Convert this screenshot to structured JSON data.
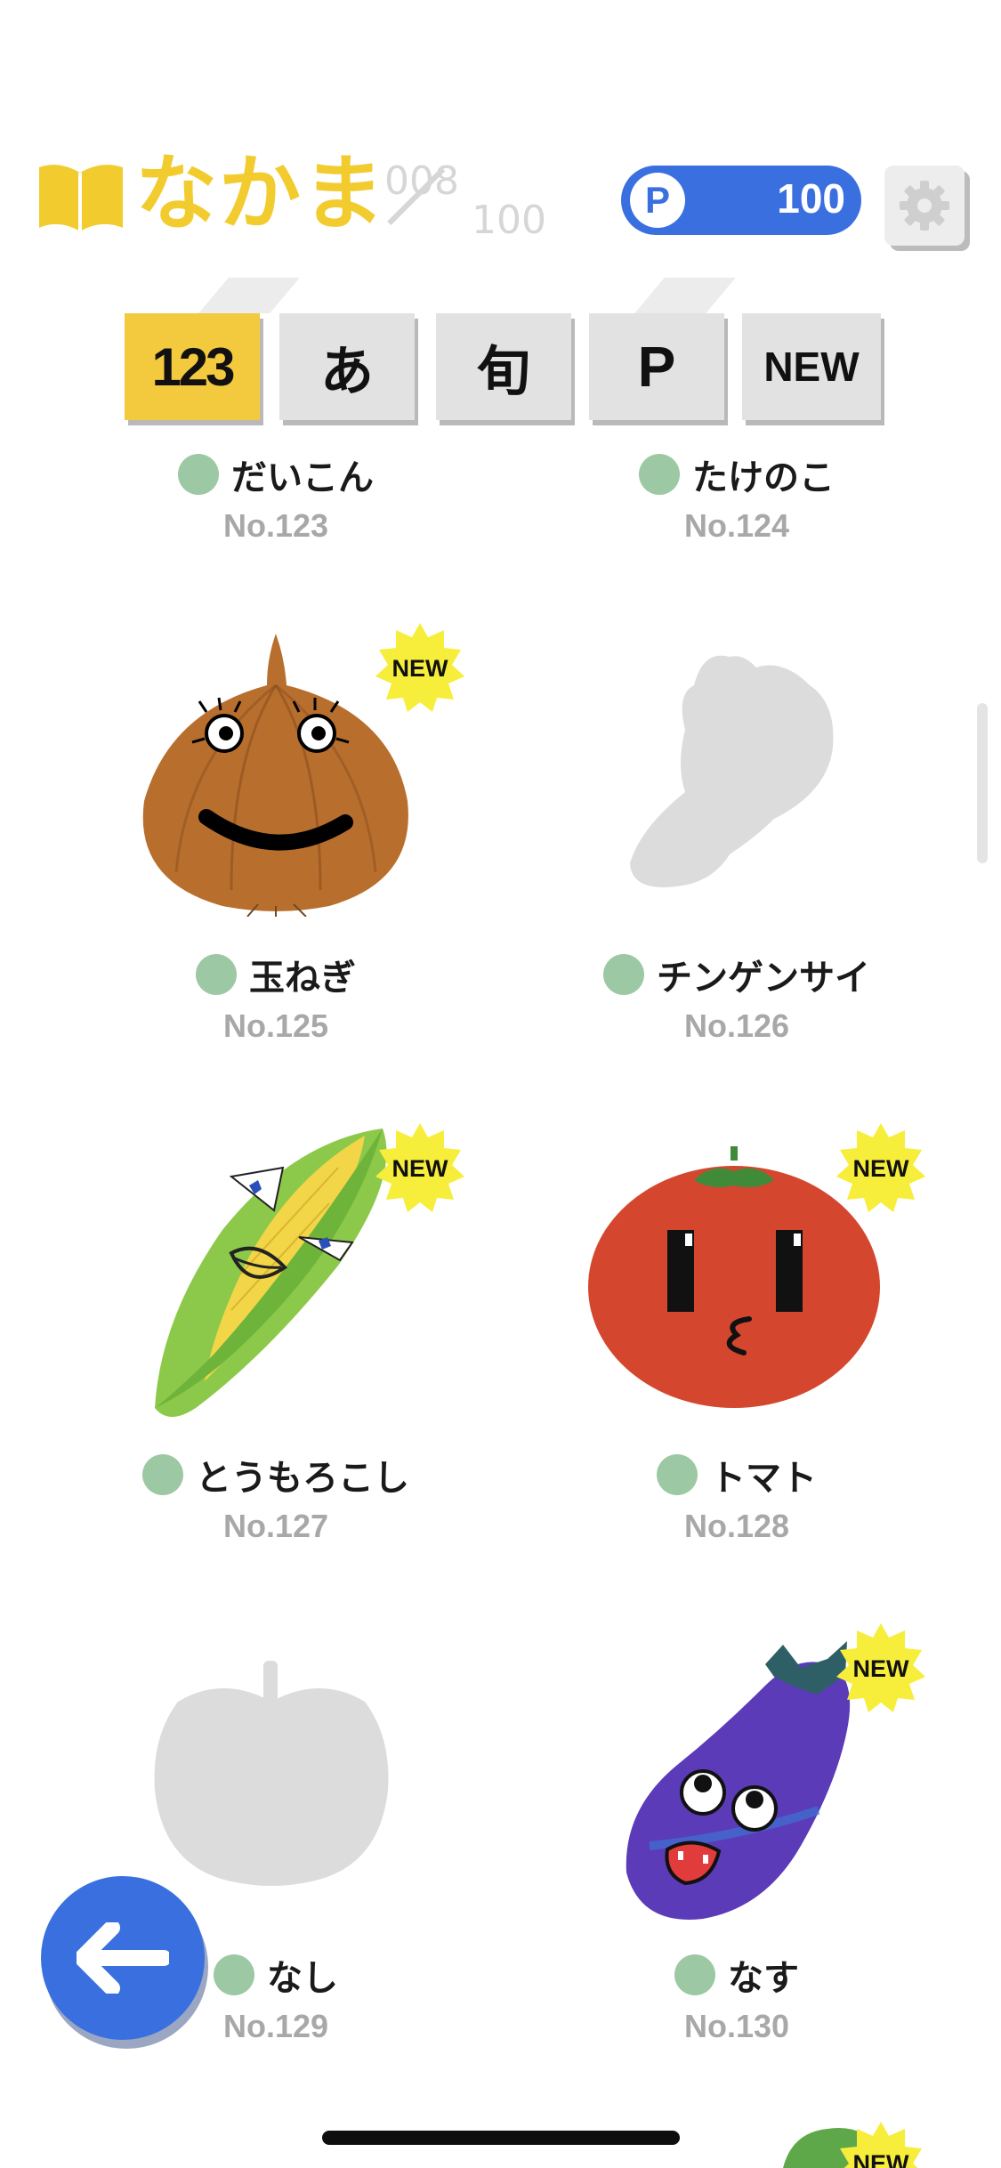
{
  "header": {
    "title": "なかま",
    "collected": "008",
    "total": "100",
    "points_label": "P",
    "points_value": "100"
  },
  "tabs": [
    {
      "label": "123",
      "active": true
    },
    {
      "label": "あ",
      "active": false
    },
    {
      "label": "旬",
      "active": false
    },
    {
      "label": "P",
      "active": false
    },
    {
      "label": "NEW",
      "active": false
    }
  ],
  "new_badge_label": "NEW",
  "items": [
    {
      "name": "だいこん",
      "number": "No.123"
    },
    {
      "name": "たけのこ",
      "number": "No.124"
    },
    {
      "name": "玉ねぎ",
      "number": "No.125",
      "is_new": true
    },
    {
      "name": "チンゲンサイ",
      "number": "No.126",
      "locked": true
    },
    {
      "name": "とうもろこし",
      "number": "No.127",
      "is_new": true
    },
    {
      "name": "トマト",
      "number": "No.128",
      "is_new": true
    },
    {
      "name": "なし",
      "number": "No.129",
      "locked": true
    },
    {
      "name": "なす",
      "number": "No.130",
      "is_new": true
    }
  ],
  "colors": {
    "accent_yellow": "#f2cc2e",
    "accent_blue": "#3a6fe0",
    "dot_green": "#9cc8a3",
    "locked_silhouette": "#dcdcdc"
  }
}
